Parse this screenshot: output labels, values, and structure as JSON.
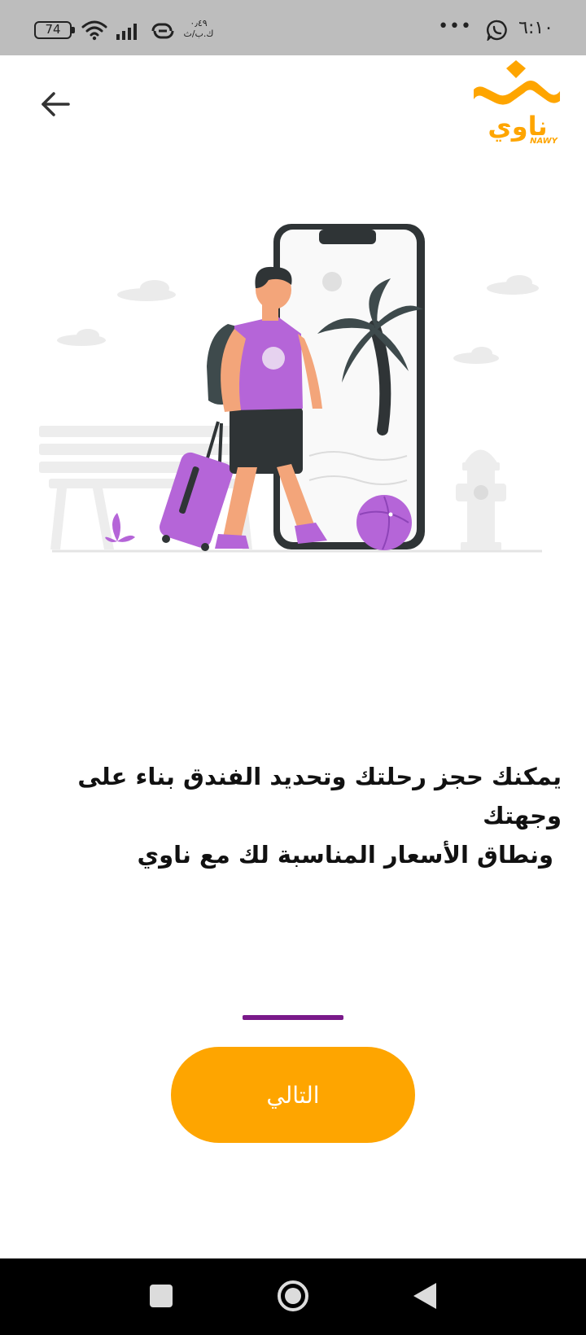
{
  "status_bar": {
    "time": "٦:١٠",
    "dots": "•••",
    "battery": "74",
    "speed_value": "٠٫٤٩",
    "speed_unit": "ك.ب/ث"
  },
  "description": {
    "line1": "يمكنك حجز رحلتك وتحديد الفندق بناء على وجهتك",
    "line2": "ونطاق الأسعار المناسبة لك مع ناوي"
  },
  "next_button": {
    "label": "التالي"
  },
  "colors": {
    "accent": "#fea500",
    "progress": "#7a1a8a",
    "purple": "#b565d8",
    "dark": "#2f3436"
  },
  "icons": {
    "back": "arrow-left-icon",
    "whatsapp": "whatsapp-icon",
    "wifi": "wifi-icon",
    "signal": "signal-icon",
    "link": "link-icon",
    "nav_recents": "square-icon",
    "nav_home": "circle-icon",
    "nav_back": "triangle-icon"
  }
}
